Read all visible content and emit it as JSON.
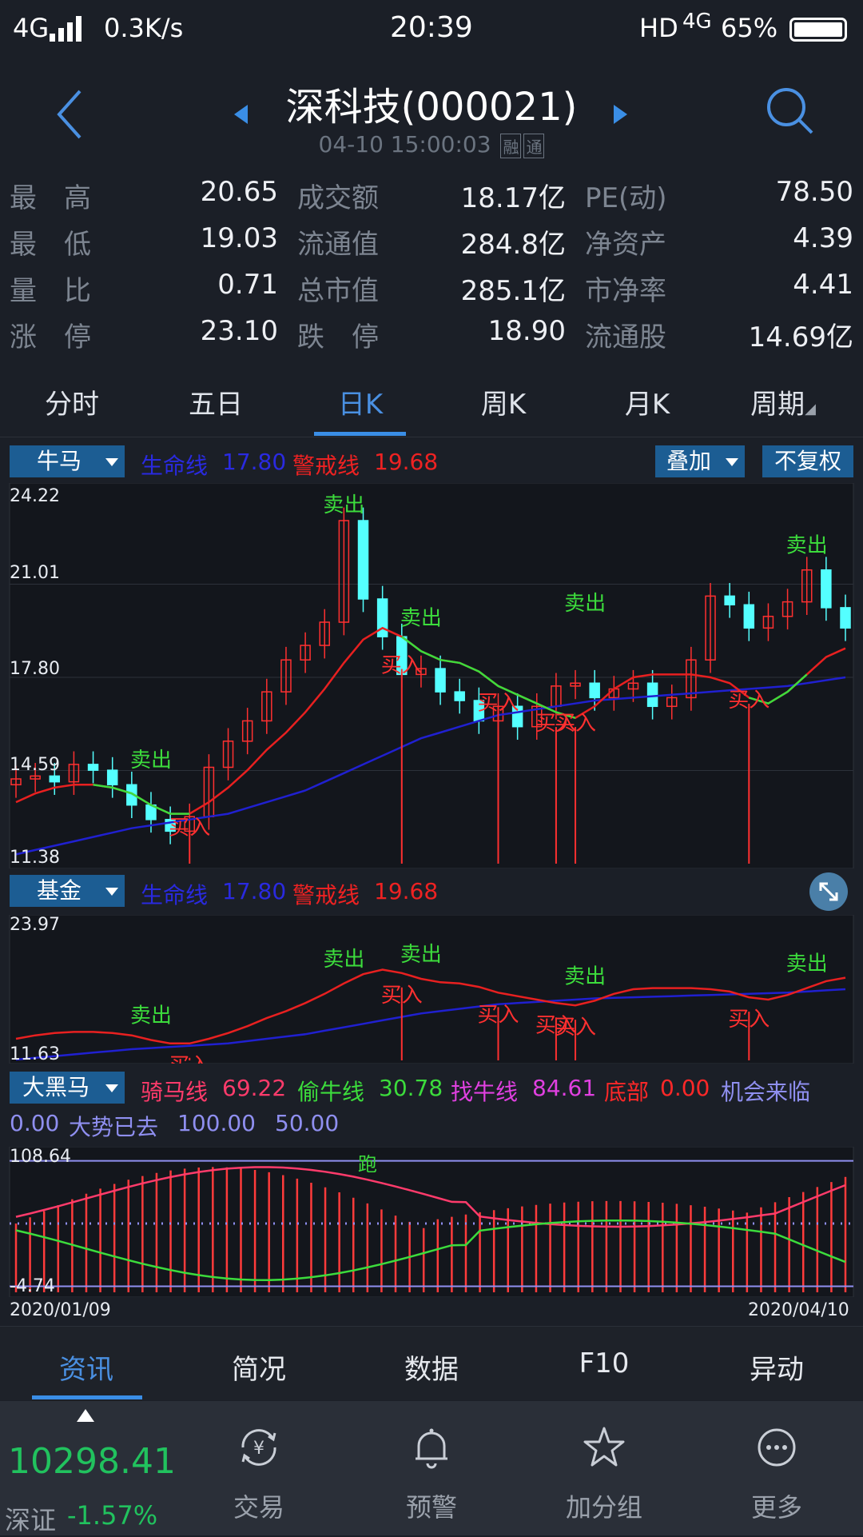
{
  "status": {
    "network": "4G",
    "speed": "0.3K/s",
    "time": "20:39",
    "hd": "HD",
    "net2": "4G",
    "battery": "65%"
  },
  "header": {
    "title": "深科技(000021)",
    "datetime": "04-10 15:00:03",
    "tags": [
      "融",
      "通"
    ]
  },
  "quote": {
    "rows": [
      [
        {
          "label": "最　高",
          "value": "20.65"
        },
        {
          "label": "成交额",
          "value": "18.17亿"
        },
        {
          "label": "PE(动)",
          "value": "78.50"
        }
      ],
      [
        {
          "label": "最　低",
          "value": "19.03"
        },
        {
          "label": "流通值",
          "value": "284.8亿"
        },
        {
          "label": "净资产",
          "value": "4.39"
        }
      ],
      [
        {
          "label": "量　比",
          "value": "0.71"
        },
        {
          "label": "总市值",
          "value": "285.1亿"
        },
        {
          "label": "市净率",
          "value": "4.41"
        }
      ],
      [
        {
          "label": "涨　停",
          "value": "23.10"
        },
        {
          "label": "跌　停",
          "value": "18.90"
        },
        {
          "label": "流通股",
          "value": "14.69亿"
        }
      ]
    ]
  },
  "period_tabs": [
    "分时",
    "五日",
    "日K",
    "周K",
    "月K",
    "周期"
  ],
  "period_active": "日K",
  "main_indicator": {
    "selector": "牛马",
    "life_label": "生命线",
    "life_value": "17.80",
    "warn_label": "警戒线",
    "warn_value": "19.68",
    "overlay_btn": "叠加",
    "adjust_btn": "不复权"
  },
  "sub_indicator": {
    "selector": "基金",
    "life_label": "生命线",
    "life_value": "17.80",
    "warn_label": "警戒线",
    "warn_value": "19.68"
  },
  "third_indicator": {
    "selector": "大黑马",
    "items": [
      {
        "label": "骑马线",
        "value": "69.22",
        "color": "#ff3b6b"
      },
      {
        "label": "偷牛线",
        "value": "30.78",
        "color": "#3cdc3c"
      },
      {
        "label": "找牛线",
        "value": "84.61",
        "color": "#e040e0"
      },
      {
        "label": "底部",
        "value": "0.00",
        "color": "#ff2828"
      },
      {
        "label": "机会来临",
        "value": "0.00",
        "color": "#8f8ff0"
      },
      {
        "label": "大势已去",
        "value": "100.00",
        "color": "#8f8ff0"
      },
      {
        "label": "",
        "value": "50.00",
        "color": "#8f8ff0"
      }
    ],
    "run_label": "跑"
  },
  "chart_data": [
    {
      "type": "candlestick",
      "title": "日K",
      "ylim": [
        11.38,
        24.22
      ],
      "y_ticks": [
        "24.22",
        "21.01",
        "17.80",
        "14.59",
        "11.38"
      ],
      "x_range": [
        "2020/01/09",
        "2020/04/10"
      ],
      "series": [
        {
          "name": "生命线",
          "color": "#2020d0",
          "values": [
            11.7,
            11.85,
            12.0,
            12.15,
            12.3,
            12.45,
            12.6,
            12.7,
            12.8,
            12.9,
            13.0,
            13.1,
            13.3,
            13.5,
            13.7,
            13.9,
            14.2,
            14.5,
            14.8,
            15.1,
            15.4,
            15.7,
            15.9,
            16.1,
            16.3,
            16.5,
            16.6,
            16.7,
            16.8,
            16.9,
            17.0,
            17.05,
            17.1,
            17.15,
            17.2,
            17.25,
            17.3,
            17.35,
            17.4,
            17.45,
            17.5,
            17.6,
            17.7,
            17.8
          ]
        },
        {
          "name": "警戒线",
          "color": "#e82020",
          "values": [
            13.5,
            13.8,
            14.0,
            14.1,
            14.1,
            14.0,
            13.8,
            13.4,
            13.1,
            13.1,
            13.5,
            14.0,
            14.6,
            15.3,
            15.9,
            16.6,
            17.4,
            18.3,
            19.1,
            19.5,
            19.2,
            18.7,
            18.4,
            18.3,
            18.0,
            17.5,
            17.2,
            16.9,
            16.6,
            16.4,
            16.8,
            17.4,
            17.8,
            17.9,
            17.9,
            17.9,
            17.8,
            17.6,
            17.1,
            16.9,
            17.3,
            17.9,
            18.5,
            18.8
          ]
        },
        {
          "name": "收盘",
          "values": [
            14.3,
            14.4,
            14.2,
            14.8,
            14.6,
            14.1,
            13.4,
            12.9,
            12.5,
            13.0,
            14.7,
            15.6,
            16.3,
            17.3,
            18.4,
            18.9,
            19.7,
            23.2,
            20.5,
            19.2,
            17.9,
            18.1,
            17.3,
            17.0,
            16.3,
            16.8,
            16.1,
            16.8,
            17.5,
            17.6,
            17.1,
            17.4,
            17.6,
            16.8,
            17.1,
            18.4,
            20.6,
            20.3,
            19.5,
            19.9,
            20.4,
            21.5,
            20.2,
            19.5
          ]
        }
      ],
      "signals": [
        {
          "label": "卖出",
          "x": "2020/01/22"
        },
        {
          "label": "买入",
          "x": "2020/02/03"
        },
        {
          "label": "卖出",
          "x": "2020/02/24"
        },
        {
          "label": "买入",
          "x": "2020/02/28"
        },
        {
          "label": "卖出",
          "x": "2020/03/03"
        },
        {
          "label": "买入",
          "x": "2020/03/10"
        },
        {
          "label": "买入",
          "x": "2020/03/16"
        },
        {
          "label": "买入",
          "x": "2020/03/18"
        },
        {
          "label": "卖出",
          "x": "2020/03/19"
        },
        {
          "label": "买入",
          "x": "2020/04/02"
        },
        {
          "label": "卖出",
          "x": "2020/04/08"
        }
      ]
    },
    {
      "type": "line",
      "title": "基金",
      "ylim": [
        11.63,
        23.97
      ],
      "y_ticks": [
        "23.97",
        "11.63"
      ],
      "series": [
        {
          "name": "生命线",
          "color": "#2020d0"
        },
        {
          "name": "警戒线",
          "color": "#e82020"
        }
      ]
    },
    {
      "type": "bar",
      "title": "大黑马",
      "ylim": [
        -4.74,
        108.64
      ],
      "y_ticks": [
        "108.64",
        "-4.74"
      ],
      "x_range": [
        "2020/01/09",
        "2020/04/10"
      ]
    }
  ],
  "bottom_tabs": [
    "资讯",
    "简况",
    "数据",
    "F10",
    "异动"
  ],
  "bottom_tab_active": "资讯",
  "index": {
    "value": "10298.41",
    "name": "深证",
    "change": "-1.57%"
  },
  "nav": [
    {
      "label": "交易",
      "icon": "yen-exchange-icon"
    },
    {
      "label": "预警",
      "icon": "bell-icon"
    },
    {
      "label": "加分组",
      "icon": "star-icon"
    },
    {
      "label": "更多",
      "icon": "more-icon"
    }
  ]
}
